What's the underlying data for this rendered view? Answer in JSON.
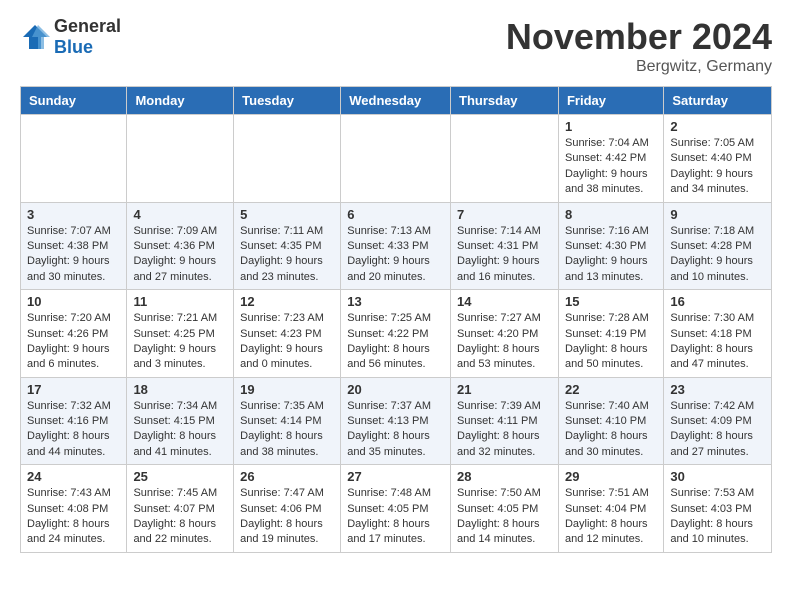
{
  "header": {
    "logo_general": "General",
    "logo_blue": "Blue",
    "month_title": "November 2024",
    "location": "Bergwitz, Germany"
  },
  "columns": [
    "Sunday",
    "Monday",
    "Tuesday",
    "Wednesday",
    "Thursday",
    "Friday",
    "Saturday"
  ],
  "weeks": [
    [
      {
        "day": "",
        "info": ""
      },
      {
        "day": "",
        "info": ""
      },
      {
        "day": "",
        "info": ""
      },
      {
        "day": "",
        "info": ""
      },
      {
        "day": "",
        "info": ""
      },
      {
        "day": "1",
        "info": "Sunrise: 7:04 AM\nSunset: 4:42 PM\nDaylight: 9 hours and 38 minutes."
      },
      {
        "day": "2",
        "info": "Sunrise: 7:05 AM\nSunset: 4:40 PM\nDaylight: 9 hours and 34 minutes."
      }
    ],
    [
      {
        "day": "3",
        "info": "Sunrise: 7:07 AM\nSunset: 4:38 PM\nDaylight: 9 hours and 30 minutes."
      },
      {
        "day": "4",
        "info": "Sunrise: 7:09 AM\nSunset: 4:36 PM\nDaylight: 9 hours and 27 minutes."
      },
      {
        "day": "5",
        "info": "Sunrise: 7:11 AM\nSunset: 4:35 PM\nDaylight: 9 hours and 23 minutes."
      },
      {
        "day": "6",
        "info": "Sunrise: 7:13 AM\nSunset: 4:33 PM\nDaylight: 9 hours and 20 minutes."
      },
      {
        "day": "7",
        "info": "Sunrise: 7:14 AM\nSunset: 4:31 PM\nDaylight: 9 hours and 16 minutes."
      },
      {
        "day": "8",
        "info": "Sunrise: 7:16 AM\nSunset: 4:30 PM\nDaylight: 9 hours and 13 minutes."
      },
      {
        "day": "9",
        "info": "Sunrise: 7:18 AM\nSunset: 4:28 PM\nDaylight: 9 hours and 10 minutes."
      }
    ],
    [
      {
        "day": "10",
        "info": "Sunrise: 7:20 AM\nSunset: 4:26 PM\nDaylight: 9 hours and 6 minutes."
      },
      {
        "day": "11",
        "info": "Sunrise: 7:21 AM\nSunset: 4:25 PM\nDaylight: 9 hours and 3 minutes."
      },
      {
        "day": "12",
        "info": "Sunrise: 7:23 AM\nSunset: 4:23 PM\nDaylight: 9 hours and 0 minutes."
      },
      {
        "day": "13",
        "info": "Sunrise: 7:25 AM\nSunset: 4:22 PM\nDaylight: 8 hours and 56 minutes."
      },
      {
        "day": "14",
        "info": "Sunrise: 7:27 AM\nSunset: 4:20 PM\nDaylight: 8 hours and 53 minutes."
      },
      {
        "day": "15",
        "info": "Sunrise: 7:28 AM\nSunset: 4:19 PM\nDaylight: 8 hours and 50 minutes."
      },
      {
        "day": "16",
        "info": "Sunrise: 7:30 AM\nSunset: 4:18 PM\nDaylight: 8 hours and 47 minutes."
      }
    ],
    [
      {
        "day": "17",
        "info": "Sunrise: 7:32 AM\nSunset: 4:16 PM\nDaylight: 8 hours and 44 minutes."
      },
      {
        "day": "18",
        "info": "Sunrise: 7:34 AM\nSunset: 4:15 PM\nDaylight: 8 hours and 41 minutes."
      },
      {
        "day": "19",
        "info": "Sunrise: 7:35 AM\nSunset: 4:14 PM\nDaylight: 8 hours and 38 minutes."
      },
      {
        "day": "20",
        "info": "Sunrise: 7:37 AM\nSunset: 4:13 PM\nDaylight: 8 hours and 35 minutes."
      },
      {
        "day": "21",
        "info": "Sunrise: 7:39 AM\nSunset: 4:11 PM\nDaylight: 8 hours and 32 minutes."
      },
      {
        "day": "22",
        "info": "Sunrise: 7:40 AM\nSunset: 4:10 PM\nDaylight: 8 hours and 30 minutes."
      },
      {
        "day": "23",
        "info": "Sunrise: 7:42 AM\nSunset: 4:09 PM\nDaylight: 8 hours and 27 minutes."
      }
    ],
    [
      {
        "day": "24",
        "info": "Sunrise: 7:43 AM\nSunset: 4:08 PM\nDaylight: 8 hours and 24 minutes."
      },
      {
        "day": "25",
        "info": "Sunrise: 7:45 AM\nSunset: 4:07 PM\nDaylight: 8 hours and 22 minutes."
      },
      {
        "day": "26",
        "info": "Sunrise: 7:47 AM\nSunset: 4:06 PM\nDaylight: 8 hours and 19 minutes."
      },
      {
        "day": "27",
        "info": "Sunrise: 7:48 AM\nSunset: 4:05 PM\nDaylight: 8 hours and 17 minutes."
      },
      {
        "day": "28",
        "info": "Sunrise: 7:50 AM\nSunset: 4:05 PM\nDaylight: 8 hours and 14 minutes."
      },
      {
        "day": "29",
        "info": "Sunrise: 7:51 AM\nSunset: 4:04 PM\nDaylight: 8 hours and 12 minutes."
      },
      {
        "day": "30",
        "info": "Sunrise: 7:53 AM\nSunset: 4:03 PM\nDaylight: 8 hours and 10 minutes."
      }
    ]
  ]
}
